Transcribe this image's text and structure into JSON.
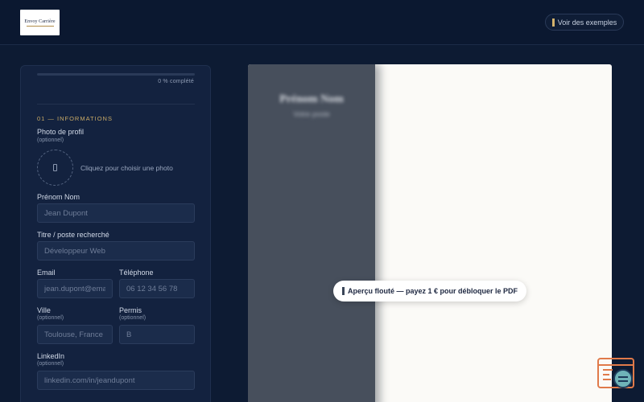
{
  "header": {
    "logo_text": "Envoy Carrière",
    "examples_button_label": "Voir des exemples"
  },
  "form": {
    "progress_percent": 0,
    "progress_label": "0 % complété",
    "section_title": "01 — INFORMATIONS",
    "photo": {
      "label": "Photo de profil",
      "optional": "(optionnel)",
      "hint": "Cliquez pour choisir une photo"
    },
    "name": {
      "label": "Prénom Nom",
      "placeholder": "Jean Dupont"
    },
    "job_title": {
      "label": "Titre / poste recherché",
      "placeholder": "Développeur Web"
    },
    "email": {
      "label": "Email",
      "placeholder": "jean.dupont@email"
    },
    "phone": {
      "label": "Téléphone",
      "placeholder": "06 12 34 56 78"
    },
    "city": {
      "label": "Ville",
      "optional": "(optionnel)",
      "placeholder": "Toulouse, France"
    },
    "license": {
      "label": "Permis",
      "optional": "(optionnel)",
      "placeholder": "B"
    },
    "linkedin": {
      "label": "LinkedIn",
      "optional": "(optionnel)",
      "placeholder": "linkedin.com/in/jeandupont"
    }
  },
  "preview": {
    "blurred_name": "Prénom Nom",
    "blurred_title": "Votre poste",
    "unlock_message": "Aperçu flouté — payez 1 € pour débloquer le PDF"
  },
  "colors": {
    "background": "#0d1b33",
    "panel": "#13223f",
    "accent": "#d3b26c",
    "preview_sidebar": "#474f5c",
    "help_widget": "#e07a4a"
  },
  "icons": {
    "examples": "document-icon",
    "photo": "camera-icon",
    "unlock": "lock-icon",
    "help": "help-chat-icon"
  }
}
